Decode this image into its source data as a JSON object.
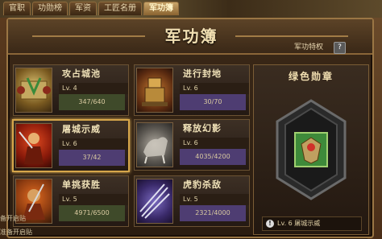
{
  "tabs": [
    "官职",
    "功勋榜",
    "军资",
    "工匠名册",
    "军功簿"
  ],
  "panel": {
    "title": "军功簿",
    "privilege_label": "军功特权",
    "help_label": "?"
  },
  "achievements": [
    {
      "name": "攻占城池",
      "level": "Lv. 4",
      "progress": "347/640"
    },
    {
      "name": "进行封地",
      "level": "Lv. 6",
      "progress": "30/70"
    },
    {
      "name": "屠城示威",
      "level": "Lv. 6",
      "progress": "37/42"
    },
    {
      "name": "释放幻影",
      "level": "Lv. 6",
      "progress": "4035/4200"
    },
    {
      "name": "单挑获胜",
      "level": "Lv. 5",
      "progress": "4971/6500"
    },
    {
      "name": "虎豹杀敌",
      "level": "Lv. 5",
      "progress": "2321/4000"
    }
  ],
  "medal": {
    "title": "绿色勋章",
    "info": "Lv. 6 屠城示威"
  },
  "footer": {
    "line1": "备开启贴",
    "line2": "准备开启贴"
  },
  "colors": {
    "accent": "#d6a64a",
    "progress_purple": "#4e3d72",
    "progress_green": "#3f4a2a",
    "medal_green": "#3e8a3a"
  }
}
